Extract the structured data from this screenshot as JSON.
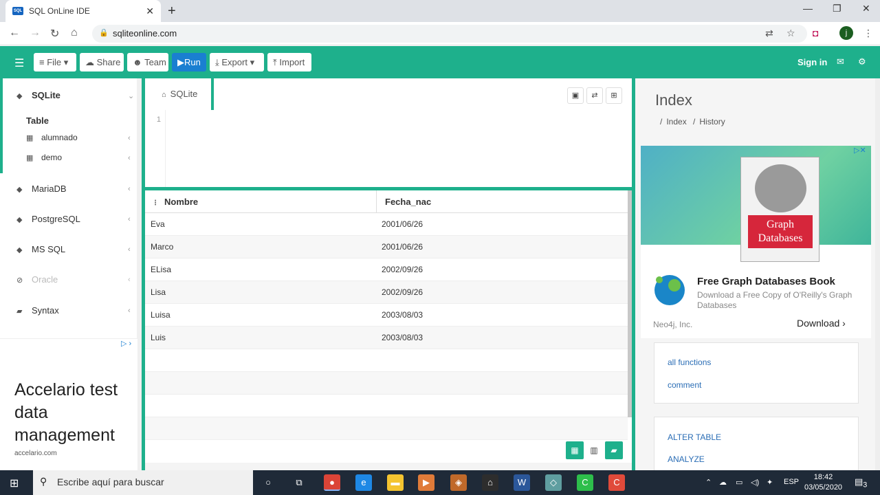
{
  "browser": {
    "tab_title": "SQL OnLine IDE",
    "favicon_text": "SQL",
    "new_tab_label": "+",
    "url": "sqliteonline.com",
    "profile_initial": "j"
  },
  "toolbar": {
    "file": "File",
    "share": "Share",
    "team": "Team",
    "run": "Run",
    "export": "Export",
    "import": "Import",
    "sign_in": "Sign in"
  },
  "sidebar": {
    "sqlite": "SQLite",
    "table_heading": "Table",
    "tables": [
      "alumnado",
      "demo"
    ],
    "mariadb": "MariaDB",
    "postgresql": "PostgreSQL",
    "mssql": "MS SQL",
    "oracle": "Oracle",
    "syntax": "Syntax",
    "ad": {
      "headline": "Accelario test data management",
      "url": "accelario.com"
    }
  },
  "editor": {
    "tab_label": "SQLite",
    "line_number": "1"
  },
  "results": {
    "columns": [
      "Nombre",
      "Fecha_nac"
    ],
    "rows": [
      [
        "Eva",
        "2001/06/26"
      ],
      [
        "Marco",
        "2001/06/26"
      ],
      [
        "ELisa",
        "2002/09/26"
      ],
      [
        "Lisa",
        "2002/09/26"
      ],
      [
        "Luisa",
        "2003/08/03"
      ],
      [
        "Luis",
        "2003/08/03"
      ]
    ]
  },
  "right_panel": {
    "title": "Index",
    "breadcrumb": [
      "Index",
      "History"
    ],
    "ad": {
      "book_title": "Graph Databases",
      "title": "Free Graph Databases Book",
      "desc": "Download a Free Copy of O'Reilly's Graph Databases",
      "brand": "Neo4j, Inc.",
      "cta": "Download"
    },
    "card1_links": [
      "all functions",
      "comment"
    ],
    "card2_links": [
      "ALTER TABLE",
      "ANALYZE"
    ]
  },
  "taskbar": {
    "search_placeholder": "Escribe aquí para buscar",
    "language": "ESP",
    "time": "18:42",
    "date": "03/05/2020",
    "notifications": "3"
  },
  "colors": {
    "accent": "#1eb08c",
    "run_button": "#1a7fd1"
  }
}
